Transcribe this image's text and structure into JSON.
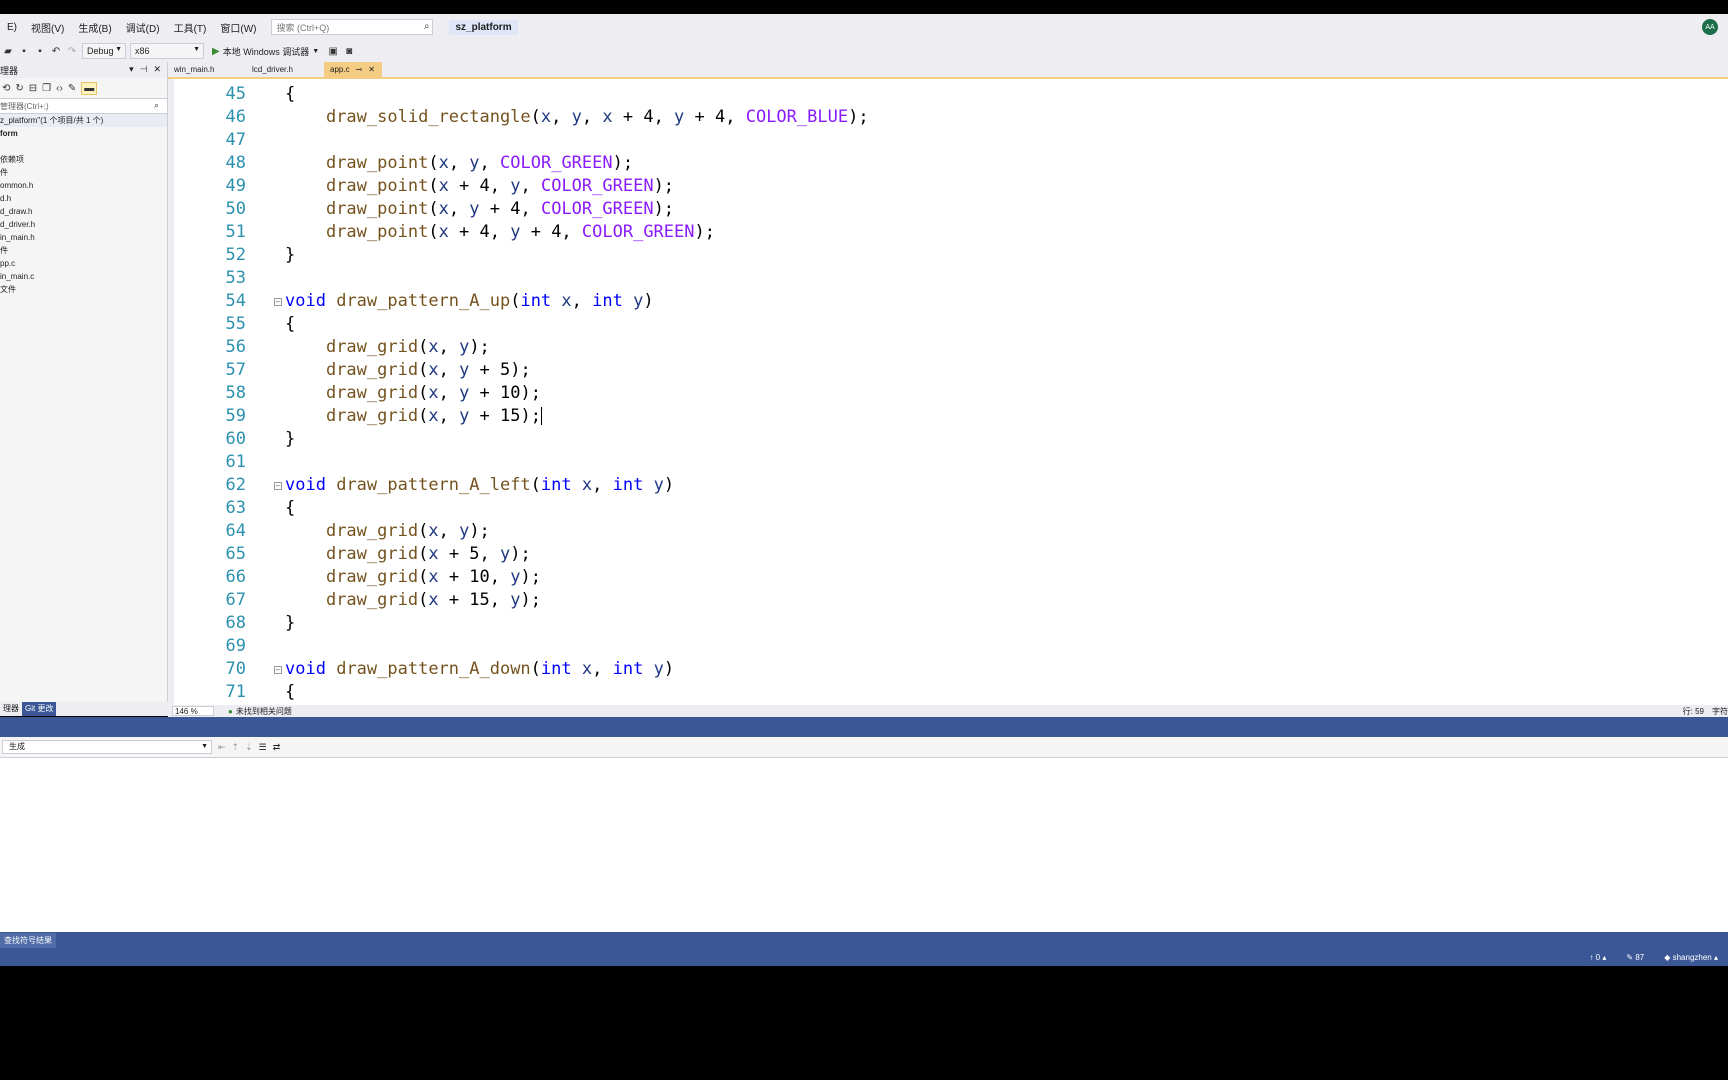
{
  "menu": {
    "items": [
      "E)",
      "视图(V)",
      "生成(B)",
      "调试(D)",
      "工具(T)",
      "窗口(W)"
    ],
    "search_placeholder": "搜索 (Ctrl+Q)",
    "solution_name": "sz_platform",
    "avatar_initials": "AA"
  },
  "toolbar": {
    "config": "Debug",
    "platform": "x86",
    "run_label": "本地 Windows 调试器"
  },
  "solution_explorer": {
    "title": "理器",
    "search_placeholder": "管理器(Ctrl+;)",
    "solution_label": "z_platform\"(1 个项目/共 1 个)",
    "items": [
      {
        "label": "form",
        "bold": true
      },
      {
        "label": ""
      },
      {
        "label": "依赖项"
      },
      {
        "label": "件"
      },
      {
        "label": "ommon.h"
      },
      {
        "label": "d.h"
      },
      {
        "label": "d_draw.h"
      },
      {
        "label": "d_driver.h"
      },
      {
        "label": "in_main.h"
      },
      {
        "label": "件"
      },
      {
        "label": "pp.c"
      },
      {
        "label": "in_main.c"
      },
      {
        "label": "文件"
      }
    ],
    "bottom_tabs": [
      "理器",
      "Git 更改"
    ]
  },
  "doc_tabs": {
    "tabs": [
      "win_main.h",
      "lcd_driver.h",
      "app.c"
    ],
    "active_index": 2
  },
  "editor": {
    "lines": [
      {
        "n": "45",
        "html": "{"
      },
      {
        "n": "46",
        "html": "    <span class='fn'>draw_solid_rectangle</span>(<span class='pv'>x</span>, <span class='pv'>y</span>, <span class='pv'>x</span> + 4, <span class='pv'>y</span> + 4, <span class='mac'>COLOR_BLUE</span>);"
      },
      {
        "n": "47",
        "html": ""
      },
      {
        "n": "48",
        "html": "    <span class='fn'>draw_point</span>(<span class='pv'>x</span>, <span class='pv'>y</span>, <span class='mac'>COLOR_GREEN</span>);"
      },
      {
        "n": "49",
        "html": "    <span class='fn'>draw_point</span>(<span class='pv'>x</span> + 4, <span class='pv'>y</span>, <span class='mac'>COLOR_GREEN</span>);"
      },
      {
        "n": "50",
        "html": "    <span class='fn'>draw_point</span>(<span class='pv'>x</span>, <span class='pv'>y</span> + 4, <span class='mac'>COLOR_GREEN</span>);"
      },
      {
        "n": "51",
        "html": "    <span class='fn'>draw_point</span>(<span class='pv'>x</span> + 4, <span class='pv'>y</span> + 4, <span class='mac'>COLOR_GREEN</span>);"
      },
      {
        "n": "52",
        "html": "}"
      },
      {
        "n": "53",
        "html": ""
      },
      {
        "n": "54",
        "html": "<span class='kw'>void</span> <span class='fn'>draw_pattern_A_up</span>(<span class='kw'>int</span> <span class='pv'>x</span>, <span class='kw'>int</span> <span class='pv'>y</span>)",
        "fold": true
      },
      {
        "n": "55",
        "html": "{"
      },
      {
        "n": "56",
        "html": "    <span class='fn'>draw_grid</span>(<span class='pv'>x</span>, <span class='pv'>y</span>);"
      },
      {
        "n": "57",
        "html": "    <span class='fn'>draw_grid</span>(<span class='pv'>x</span>, <span class='pv'>y</span> + 5);"
      },
      {
        "n": "58",
        "html": "    <span class='fn'>draw_grid</span>(<span class='pv'>x</span>, <span class='pv'>y</span> + 10);"
      },
      {
        "n": "59",
        "html": "    <span class='fn'>draw_grid</span>(<span class='pv'>x</span>, <span class='pv'>y</span> + 15);<span class='caret'></span>"
      },
      {
        "n": "60",
        "html": "}"
      },
      {
        "n": "61",
        "html": ""
      },
      {
        "n": "62",
        "html": "<span class='kw'>void</span> <span class='fn'>draw_pattern_A_left</span>(<span class='kw'>int</span> <span class='pv'>x</span>, <span class='kw'>int</span> <span class='pv'>y</span>)",
        "fold": true
      },
      {
        "n": "63",
        "html": "{"
      },
      {
        "n": "64",
        "html": "    <span class='fn'>draw_grid</span>(<span class='pv'>x</span>, <span class='pv'>y</span>);"
      },
      {
        "n": "65",
        "html": "    <span class='fn'>draw_grid</span>(<span class='pv'>x</span> + 5, <span class='pv'>y</span>);"
      },
      {
        "n": "66",
        "html": "    <span class='fn'>draw_grid</span>(<span class='pv'>x</span> + 10, <span class='pv'>y</span>);"
      },
      {
        "n": "67",
        "html": "    <span class='fn'>draw_grid</span>(<span class='pv'>x</span> + 15, <span class='pv'>y</span>);"
      },
      {
        "n": "68",
        "html": "}"
      },
      {
        "n": "69",
        "html": ""
      },
      {
        "n": "70",
        "html": "<span class='kw'>void</span> <span class='fn'>draw_pattern_A_down</span>(<span class='kw'>int</span> <span class='pv'>x</span>, <span class='kw'>int</span> <span class='pv'>y</span>)",
        "fold": true
      },
      {
        "n": "71",
        "html": "{"
      }
    ]
  },
  "editor_status": {
    "zoom": "146 %",
    "issues": "未找到相关问题",
    "position": "行: 59",
    "encoding": "字符"
  },
  "output": {
    "source": "生成"
  },
  "bottom_tabs": [
    "查找符号结果"
  ],
  "status": {
    "git_up": "0",
    "edits": "87",
    "branch": "shangzhen"
  }
}
